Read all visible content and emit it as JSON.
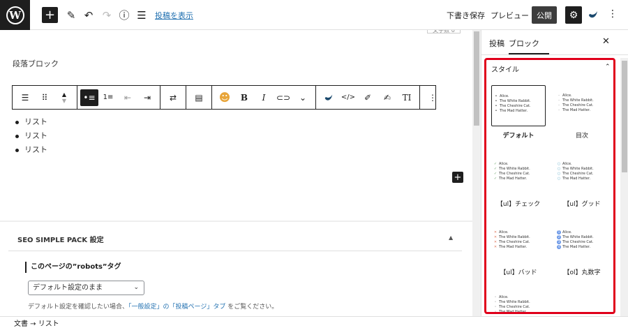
{
  "topbar": {
    "logo": "W",
    "view_post_link": "投稿を表示",
    "draft_label": "下書き保存",
    "preview_label": "プレビュー",
    "publish_label": "公開",
    "icons": [
      "plus-icon",
      "pen-icon",
      "undo-icon",
      "redo-icon",
      "info-icon",
      "list-view-icon",
      "gear-icon",
      "swell-icon",
      "kebab-icon"
    ]
  },
  "editor": {
    "top_tag": "文字数 0",
    "paragraph": "段落ブロック",
    "list_items": [
      "リスト",
      "リスト",
      "リスト"
    ],
    "toolbar": {
      "bold": "B",
      "italic": "I",
      "text_type": "TI"
    }
  },
  "seo": {
    "title": "SEO SIMPLE PACK 設定",
    "robots_label": "このページの”robots”タグ",
    "robots_value": "デフォルト設定のまま",
    "note_prefix": "デフォルト設定を確認したい場合、",
    "note_link": "「一般設定」の「投稿ページ」タブ",
    "note_suffix": " をご覧ください。"
  },
  "sidebar": {
    "tab_post": "投稿",
    "tab_block": "ブロック",
    "style_heading": "スタイル",
    "sample_lines": [
      "Alice.",
      "The White Rabbit.",
      "The Cheshire Cat.",
      "The Mad Hatter."
    ],
    "styles": [
      {
        "label": "デフォルト",
        "marker": "•",
        "kind": "dot",
        "selected": true
      },
      {
        "label": "目次",
        "marker": "·",
        "kind": "dot",
        "selected": false
      },
      {
        "label": "【ul】チェック",
        "marker": "✓",
        "kind": "check",
        "selected": false
      },
      {
        "label": "【ul】グッド",
        "marker": "○",
        "kind": "good",
        "selected": false
      },
      {
        "label": "【ul】バッド",
        "marker": "✕",
        "kind": "bad",
        "selected": false
      },
      {
        "label": "【ol】丸数字",
        "marker": "",
        "kind": "num",
        "selected": false
      },
      {
        "label": "",
        "marker": "◦",
        "kind": "dot",
        "selected": false
      }
    ],
    "highlight_color": "#e0001b"
  },
  "footer": {
    "breadcrumb": "文書 → リスト"
  }
}
